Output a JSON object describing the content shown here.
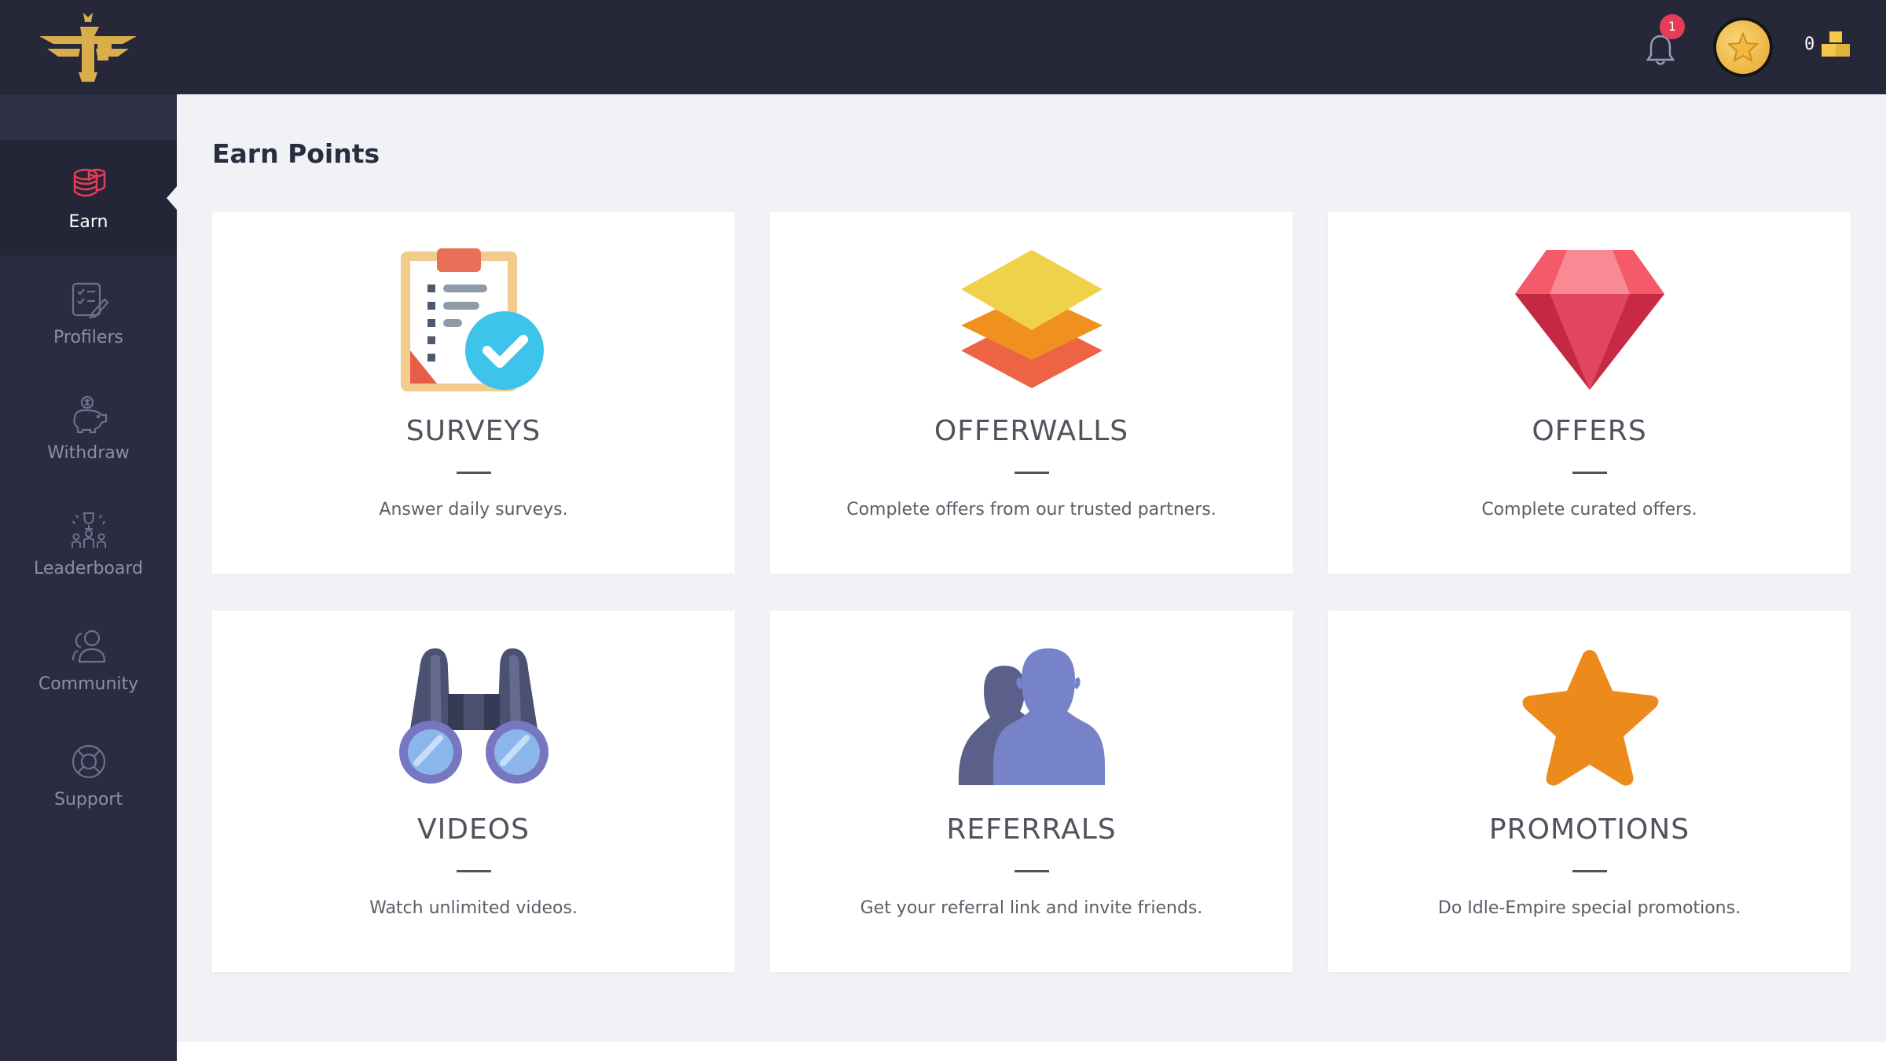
{
  "header": {
    "notifications_count": "1",
    "points_balance": "0"
  },
  "sidebar": {
    "items": [
      {
        "label": "Earn",
        "icon": "coins-icon",
        "active": true
      },
      {
        "label": "Profilers",
        "icon": "checklist-icon",
        "active": false
      },
      {
        "label": "Withdraw",
        "icon": "piggy-bank-icon",
        "active": false
      },
      {
        "label": "Leaderboard",
        "icon": "trophy-people-icon",
        "active": false
      },
      {
        "label": "Community",
        "icon": "users-icon",
        "active": false
      },
      {
        "label": "Support",
        "icon": "lifebuoy-icon",
        "active": false
      }
    ]
  },
  "main": {
    "title": "Earn Points",
    "cards": [
      {
        "title": "SURVEYS",
        "description": "Answer daily surveys.",
        "icon": "clipboard-check-icon"
      },
      {
        "title": "OFFERWALLS",
        "description": "Complete offers from our trusted partners.",
        "icon": "layers-icon"
      },
      {
        "title": "OFFERS",
        "description": "Complete curated offers.",
        "icon": "diamond-icon"
      },
      {
        "title": "VIDEOS",
        "description": "Watch unlimited videos.",
        "icon": "binoculars-icon"
      },
      {
        "title": "REFERRALS",
        "description": "Get your referral link and invite friends.",
        "icon": "people-icon"
      },
      {
        "title": "PROMOTIONS",
        "description": "Do Idle-Empire special promotions.",
        "icon": "star-icon"
      }
    ]
  },
  "colors": {
    "topbar": "#262839",
    "sidebar": "#2a2c40",
    "background": "#f1f2f6",
    "accent_gold": "#e8b63c",
    "accent_red": "#e63c57"
  }
}
